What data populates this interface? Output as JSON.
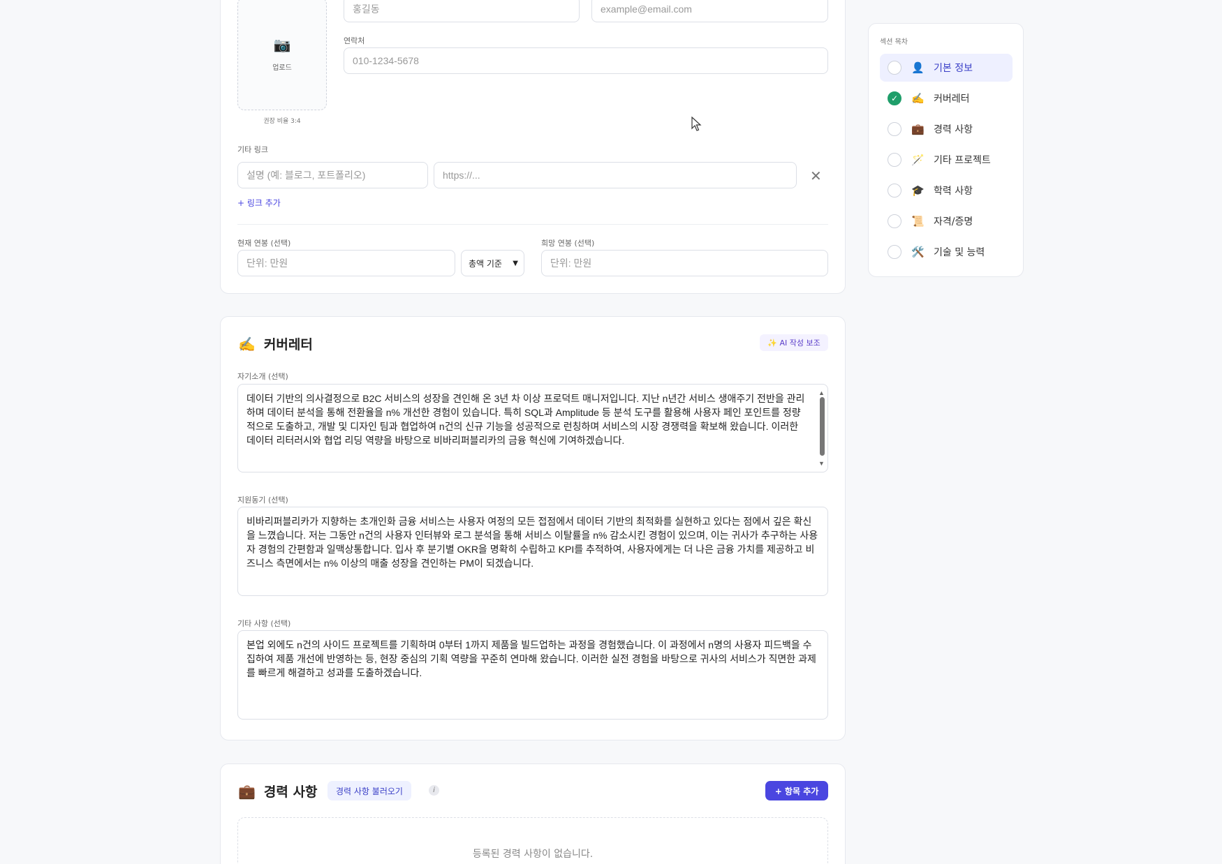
{
  "basic": {
    "name_placeholder": "홍길동",
    "email_placeholder": "example@email.com",
    "contact_label": "연락처",
    "contact_placeholder": "010-1234-5678",
    "photo_label": "업로드",
    "photo_hint": "권장 비율 3:4",
    "links_label": "기타 링크",
    "link_desc_placeholder": "설명 (예: 블로그, 포트폴리오)",
    "link_url_placeholder": "https://...",
    "add_link": "+ 링크 추가",
    "current_salary_label": "현재 연봉 (선택)",
    "current_salary_placeholder": "단위: 만원",
    "salary_basis": "총액 기준",
    "desired_salary_label": "희망 연봉 (선택)",
    "desired_salary_placeholder": "단위: 만원"
  },
  "cover": {
    "icon": "writing-hand-icon",
    "title": "커버레터",
    "ai_button": "✨ AI 작성 보조",
    "intro_label": "자기소개 (선택)",
    "intro_text": "데이터 기반의 의사결정으로 B2C 서비스의 성장을 견인해 온 3년 차 이상 프로덕트 매니저입니다. 지난 n년간 서비스 생애주기 전반을 관리하며 데이터 분석을 통해 전환율을 n% 개선한 경험이 있습니다. 특히 SQL과 Amplitude 등 분석 도구를 활용해 사용자 페인 포인트를 정량적으로 도출하고, 개발 및 디자인 팀과 협업하여 n건의 신규 기능을 성공적으로 런칭하며 서비스의 시장 경쟁력을 확보해 왔습니다. 이러한 데이터 리터러시와 협업 리딩 역량을 바탕으로 비바리퍼블리카의 금융 혁신에 기여하겠습니다.",
    "motivation_label": "지원동기 (선택)",
    "motivation_text": "비바리퍼블리카가 지향하는 초개인화 금융 서비스는 사용자 여정의 모든 접점에서 데이터 기반의 최적화를 실현하고 있다는 점에서 깊은 확신을 느꼈습니다. 저는 그동안 n건의 사용자 인터뷰와 로그 분석을 통해 서비스 이탈률을 n% 감소시킨 경험이 있으며, 이는 귀사가 추구하는 사용자 경험의 간편함과 일맥상통합니다. 입사 후 분기별 OKR을 명확히 수립하고 KPI를 추적하여, 사용자에게는 더 나은 금융 가치를 제공하고 비즈니스 측면에서는 n% 이상의 매출 성장을 견인하는 PM이 되겠습니다.",
    "other_label": "기타 사항 (선택)",
    "other_text": "본업 외에도 n건의 사이드 프로젝트를 기획하며 0부터 1까지 제품을 빌드업하는 과정을 경험했습니다. 이 과정에서 n명의 사용자 피드백을 수집하여 제품 개선에 반영하는 등, 현장 중심의 기획 역량을 꾸준히 연마해 왔습니다. 이러한 실전 경험을 바탕으로 귀사의 서비스가 직면한 과제를 빠르게 해결하고 성과를 도출하겠습니다."
  },
  "career": {
    "icon": "briefcase-icon",
    "title": "경력 사항",
    "import_button": "경력 사항 불러오기",
    "info_icon": "info-icon",
    "add_button": "+ 항목 추가",
    "empty_text": "등록된 경력 사항이 없습니다."
  },
  "toc": {
    "title": "섹션 목차",
    "items": [
      {
        "label": "기본 정보",
        "icon": "👤",
        "done": false,
        "active": true
      },
      {
        "label": "커버레터",
        "icon": "✍️",
        "done": true,
        "active": false
      },
      {
        "label": "경력 사항",
        "icon": "💼",
        "done": false,
        "active": false
      },
      {
        "label": "기타 프로젝트",
        "icon": "🪄",
        "done": false,
        "active": false
      },
      {
        "label": "학력 사항",
        "icon": "🎓",
        "done": false,
        "active": false
      },
      {
        "label": "자격/증명",
        "icon": "📜",
        "done": false,
        "active": false
      },
      {
        "label": "기술 및 능력",
        "icon": "🛠️",
        "done": false,
        "active": false
      }
    ]
  },
  "colors": {
    "accent": "#4a46e0",
    "success": "#1f9e6a",
    "active_bg": "#eef0ff"
  }
}
